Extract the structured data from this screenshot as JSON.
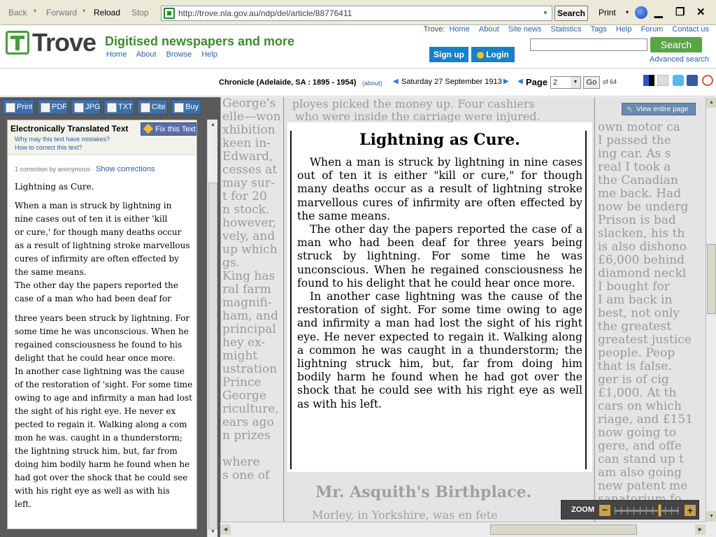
{
  "browser": {
    "back": "Back",
    "forward": "Forward",
    "reload": "Reload",
    "stop": "Stop",
    "url": "http://trove.nla.gov.au/ndp/del/article/88776411",
    "search": "Search",
    "print": "Print"
  },
  "header": {
    "logo": "Trove",
    "tagline": "Digitised newspapers and more",
    "nav": [
      "Home",
      "About",
      "Browse",
      "Help"
    ],
    "top_label": "Trove:",
    "top_links": [
      "Home",
      "About",
      "Site news",
      "Statistics",
      "Tags",
      "Help",
      "Forum",
      "Contact us"
    ],
    "signup": "Sign up",
    "login": "Login",
    "search_button": "Search",
    "advanced_search": "Advanced search"
  },
  "title_bar": {
    "publication": "Chronicle (Adelaide, SA : 1895 - 1954)",
    "about": "(about)",
    "date": "Saturday 27 September 1913",
    "page_label": "Page",
    "page_value": "2",
    "go": "Go",
    "of_pages": "of 64"
  },
  "tools": [
    "Print",
    "PDF",
    "JPG",
    "TXT",
    "Cite",
    "Buy"
  ],
  "text_panel": {
    "title": "Electronically Translated Text",
    "why": "Why may this text have mistakes?",
    "how": "How to correct this text?",
    "fix": "Fix this Text",
    "correction": "1 correction by anonymous",
    "show_corrections": "Show corrections",
    "heading": "Lightning as Cure.",
    "lines_a": [
      "When a man is struck by lightning in",
      "nine cases out of ten it is either 'kill",
      "or cure,' for though many deaths occur",
      "as a result of lightning stroke marvellous",
      "cures of infirmity are often effected by",
      "the same means.",
      "The other day the papers reported the",
      "case of a man who had been deaf for"
    ],
    "lines_b": [
      "three years been struck by lightning. For",
      "some time he was unconscious. When he",
      "regained consciousness he found to his",
      "delight that he could hear once more.",
      "In another case lightning was the cause",
      "of the restoration of 'sight. For some time",
      "owing to age and infirmity a man had lost",
      "the sight of his right eye. He never ex",
      "pected to regain it. Walking along a com",
      "mon he was. caught in a thunderstorm;",
      "the lightning struck him, but, far from",
      "doing him bodily harm he found when he",
      "had got over the shock that he could see",
      "with his right eye as well as with his",
      "left."
    ]
  },
  "article": {
    "title": "Lightning as Cure.",
    "p1": "When a man is struck by lightning in nine cases out of ten it is either \"kill or cure,\" for though many deaths occur as a result of lightning stroke marvellous cures of infirmity are often effected by the same means.",
    "p2": "The other day the papers reported the case of a man who had been deaf for three years being struck by lightning. For some time he was unconscious. When he regained consciousness he found to his delight that he could hear once more.",
    "p3": "In another case lightning was the cause of the restoration of sight. For some time owing to age and infirmity a man had lost the sight of his right eye. He never expected to regain it. Walking along a common he was caught in a thunderstorm; the lightning struck him, but, far from doing him bodily harm he found when he had got over the shock that he could see with his right eye as well as with his left.",
    "above_line_1": "ployes picked the money up. Four cashiers",
    "above_line_2": "who were inside the carriage were injured.",
    "lower_heading": "Mr. Asquith's Birthplace.",
    "lower_line": "Morley, in Yorkshire, was en fete"
  },
  "faded_left": "George's\nelle—won\nxhibition\nkeen in-\nEdward,\ncesses at\nmay sur-\nt for 20\nn stock.\nhowever,\nvely, and\nup which\ngs.\nKing has\nral farm\nmagnifi-\nham, and\nprincipal\nhey ex-\nmight\nustration\nPrince\nGeorge\nriculture,\nears ago\nn prizes\n\nwhere\ns one of",
  "faded_right": "own motor ca\nI passed the\ning car. As s\nreal I took a\nthe Canadian\nme back. Had\nnow be underg\nPrison is bad\nslacken, his th\nis also dishono\n£6,000 behind\ndiamond neckl\nI bought for\nI am back in\nbest, not only\nthe greatest\ngreatest justice\npeople. Peop\nthat is false.\nger is of cig\n£1,000. At th\ncars on which\nriage, and £151\nnow going to\ngere, and offe\ncan stand up t\nam also going\nnew patent me\nsanatorium fo",
  "viewer": {
    "view_entire": "View entire page",
    "zoom": "ZOOM",
    "zoom_level": 0.7
  }
}
